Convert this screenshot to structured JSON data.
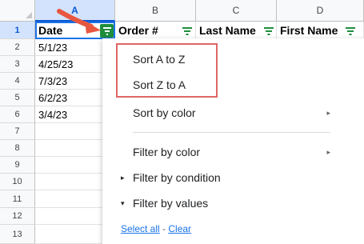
{
  "columns": [
    "A",
    "B",
    "C",
    "D"
  ],
  "rows": [
    "1",
    "2",
    "3",
    "4",
    "5",
    "6",
    "7",
    "8",
    "9",
    "10",
    "11",
    "12",
    "13"
  ],
  "header_row": {
    "date": "Date",
    "order": "Order #",
    "last_name": "Last Name",
    "first_name": "First Name"
  },
  "dates": [
    "5/1/23",
    "4/25/23",
    "7/3/23",
    "6/2/23",
    "3/4/23"
  ],
  "menu": {
    "sort_az": "Sort A to Z",
    "sort_za": "Sort Z to A",
    "sort_by_color": "Sort by color",
    "filter_by_color": "Filter by color",
    "filter_by_condition": "Filter by condition",
    "filter_by_values": "Filter by values",
    "select_all": "Select all",
    "separator": " - ",
    "clear": "Clear"
  },
  "icons": {
    "submenu_arrow": "▸",
    "collapsed_caret": "▸",
    "expanded_caret": "▾"
  },
  "colors": {
    "filter_active": "#1e8e3e",
    "highlight_box": "#e06666",
    "arrow": "#e8563f",
    "selection": "#0b57d0"
  }
}
